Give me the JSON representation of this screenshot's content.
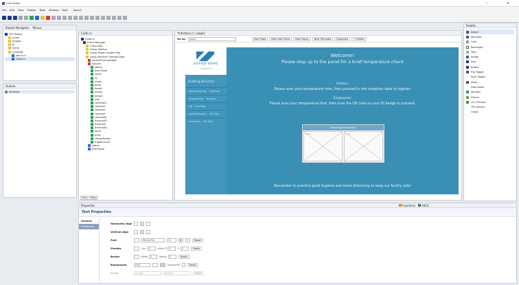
{
  "window": {
    "title": "Core Studio",
    "minimize_glyph": "–",
    "close_glyph": "×"
  },
  "menu": [
    "File",
    "Edit",
    "View",
    "Publish",
    "Tools",
    "Window",
    "Help",
    "Search"
  ],
  "navigator": {
    "tabs": [
      "Project Navigator",
      "Menus"
    ],
    "items": [
      "TFS Master",
      "Audio",
      "Images",
      "JS",
      "Serial",
      "scriptpdf",
      "admin.ci",
      "Code.cc"
    ]
  },
  "outline": {
    "tab": "Outline",
    "items": [
      "Interface"
    ]
  },
  "code_panel": {
    "tab": "Code.cc",
    "root": "Code.cc",
    "manager": "Event Manager",
    "groups": [
      "Group App",
      "Group Startup",
      "Group Power System Info",
      "Group Receive Thermal Data"
    ],
    "leaves": [
      "receiveThermalData",
      "convert",
      "status",
      "eventType",
      "count",
      "id",
      "mode",
      "temp",
      "temp1",
      "temp2",
      "temp3",
      "unit",
      "camera01",
      "camera1",
      "camera5",
      "camera9",
      "camera61",
      "thermal01",
      "thermal5",
      "thermal61",
      "hand",
      "error",
      "sensorButton",
      "triggerCount",
      "status",
      "eventType"
    ],
    "bottom_tabs": [
      "Tree",
      "Table"
    ]
  },
  "editor": {
    "tab": "*Interface.ci / page1",
    "goto_label": "Go to:",
    "goto_value": "page1",
    "buttons": [
      "New Page",
      "New Side Panel",
      "New Popup",
      "New Template",
      "Duplicate",
      "Delete"
    ]
  },
  "screen": {
    "brand": "BRAND NAME",
    "tagline": "CAREGIVING",
    "welcome": "Welcome!",
    "step": "Please step up to the panel for a brief temperature check",
    "directory_title": "Building Directory",
    "directory": [
      [
        "Manufacturing",
        "2nd floor"
      ],
      [
        "Engineering",
        "3rd floor"
      ],
      [
        "HR",
        "2nd floor"
      ],
      [
        "Administrative",
        "4th floor"
      ],
      [
        "Executive",
        "4th floor"
      ]
    ],
    "visitors_title": "Visitors:",
    "visitors_text": "Please scan your temperature here, then proceed to the reception desk to register.",
    "employees_title": "Employees:",
    "employees_text": "Please scan your temperature first, then scan the QR code on your ID badge to proceed.",
    "scan_title": "Scanning Status/Unit",
    "scan_cells": [
      "Status",
      "Unit"
    ],
    "footer": "Remember to practice good hygiene and social distancing to keep our facility safe!"
  },
  "palette": {
    "tab": "Palette",
    "items": [
      "Select",
      "Marquee",
      "Oval",
      "Rectangle",
      "Text",
      "Image",
      "Icon",
      "Button",
      "Flip Toggle",
      "Push Toggle",
      "Slider",
      "Drop Down",
      "Spinbox",
      "iFrame",
      "VLS Preview",
      "TFS Stream",
      "Group"
    ]
  },
  "properties": {
    "tab": "Properties",
    "functions_tab": "Functions",
    "ascii_tab": "ASCII",
    "section": "Text Properties",
    "side": [
      "General",
      "Commands"
    ],
    "rows": [
      {
        "label": "Horizontal align"
      },
      {
        "label": "Vertical align"
      },
      {
        "label": "Font",
        "value": "Myriad Pro",
        "size": "12",
        "bold": "B",
        "italic": "I",
        "reset": "Reset"
      },
      {
        "label": "Shadow",
        "size_label": "Size",
        "size": "0",
        "offh_label": "offset H",
        "offh": "0",
        "v_label": "V",
        "v": "0",
        "reset": "Reset"
      },
      {
        "label": "Border",
        "width_label": "Width",
        "width": "0",
        "radius_label": "Radius",
        "radius": "0",
        "reset": "Reset"
      },
      {
        "label": "Background",
        "value": "plain",
        "transparent": "transparent",
        "reset": "Reset"
      },
      {
        "label": "Image",
        "value": "sample",
        "value2": "sample",
        "reset": "Reset"
      }
    ]
  }
}
